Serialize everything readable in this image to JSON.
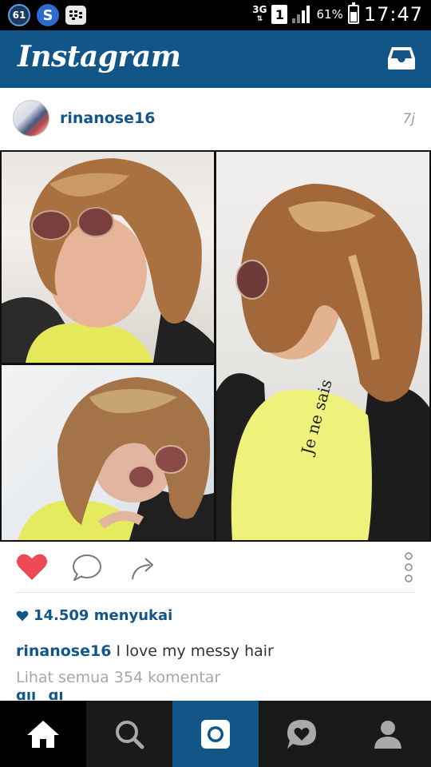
{
  "status_bar": {
    "notification_badge": "61",
    "skype_letter": "S",
    "bbm_label": "BBM",
    "network": "3G",
    "network_arrows": "⇅",
    "sim_slot": "1",
    "battery": "61%",
    "time": "17:47"
  },
  "header": {
    "brand": "Instagram",
    "inbox_icon": "inbox-icon"
  },
  "post": {
    "username": "rinanose16",
    "time_ago": "7j",
    "likes_text": "14.509 menyukai",
    "caption_user": "rinanose16",
    "caption_text": "I love my messy hair",
    "view_comments": "Lihat semua 354 komentar",
    "comment_peek": "dii _di"
  },
  "actions": {
    "like": "heart-icon",
    "comment": "comment-icon",
    "share": "share-icon",
    "more": "more-options-icon"
  },
  "colors": {
    "brand_blue": "#125688",
    "like_red": "#ed4956",
    "nav_dark": "#1a1a1a"
  },
  "nav": [
    "home-icon",
    "search-icon",
    "camera-icon",
    "activity-icon",
    "profile-icon"
  ]
}
